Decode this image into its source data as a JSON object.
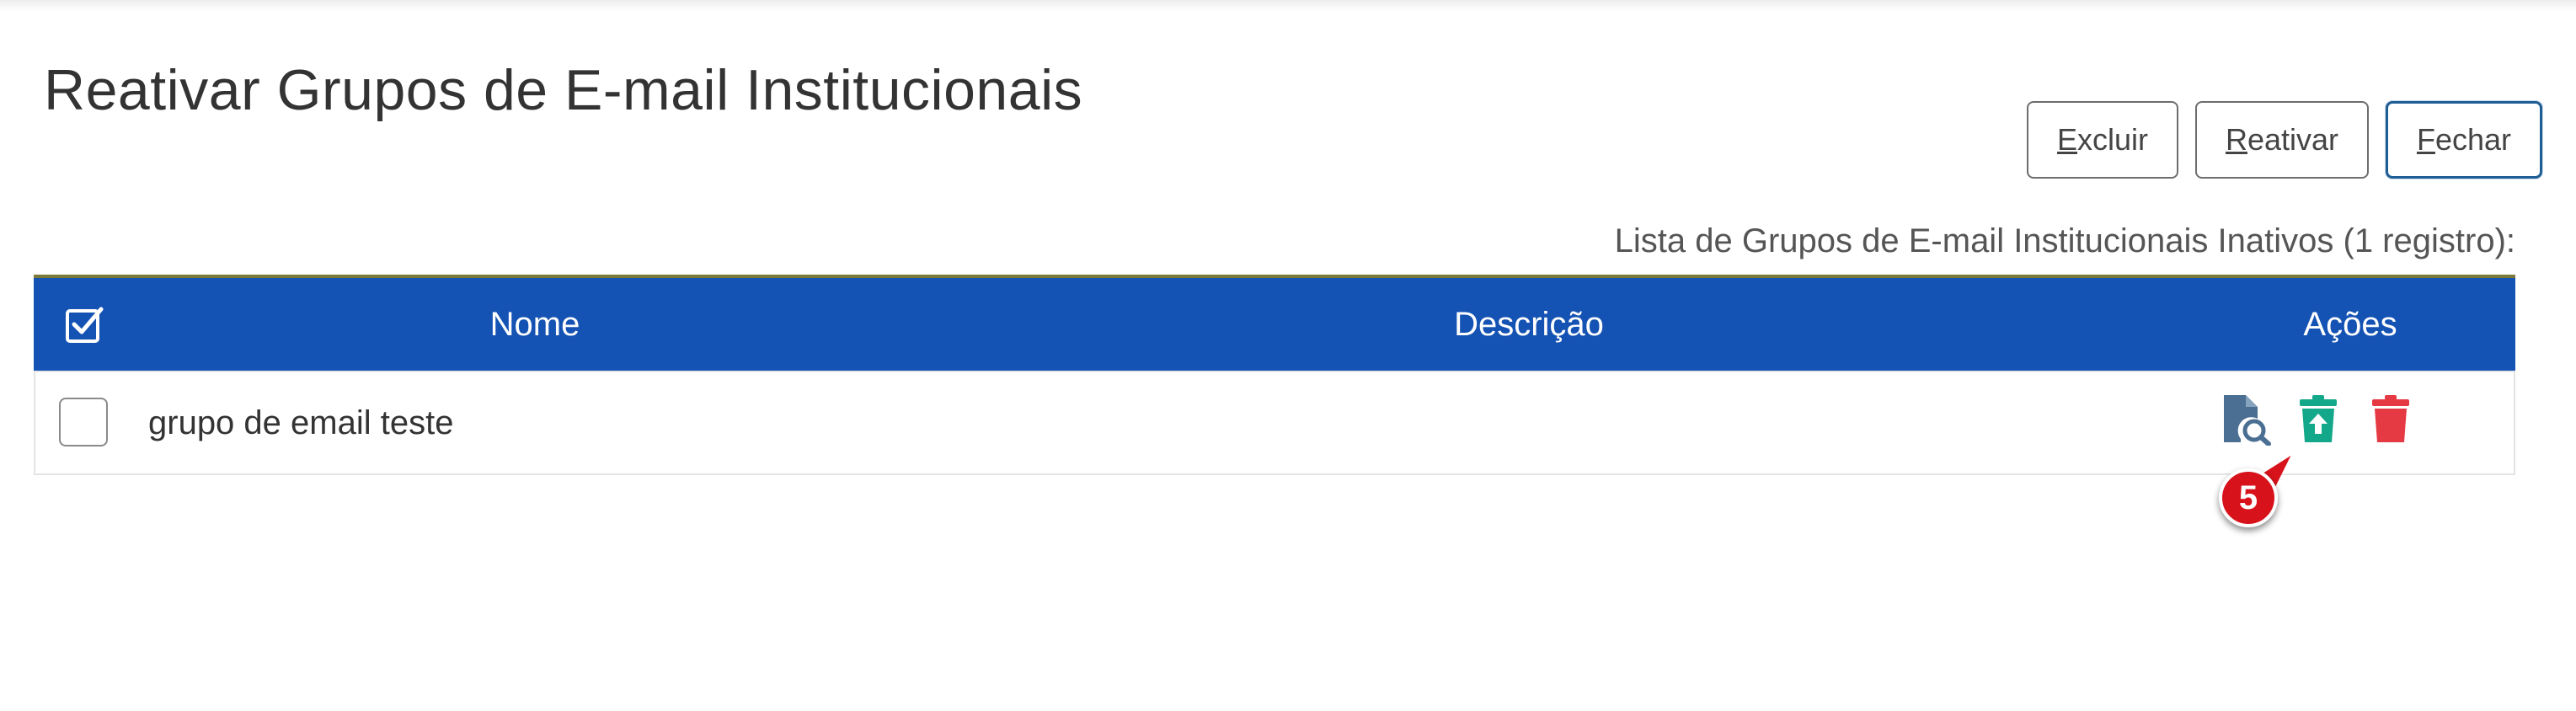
{
  "page": {
    "title": "Reativar Grupos de E-mail Institucionais"
  },
  "toolbar": {
    "excluir": {
      "mnemonic": "E",
      "rest": "xcluir"
    },
    "reativar": {
      "mnemonic": "R",
      "rest": "eativar"
    },
    "fechar": {
      "mnemonic": "F",
      "rest": "echar"
    }
  },
  "table": {
    "caption": "Lista de Grupos de E-mail Institucionais Inativos (1 registro):",
    "headers": {
      "nome": "Nome",
      "descricao": "Descrição",
      "acoes": "Ações"
    },
    "rows": [
      {
        "nome": "grupo de email teste",
        "descricao": "",
        "selected": false
      }
    ]
  },
  "annotation": {
    "badge_number": "5"
  },
  "colors": {
    "header_bg": "#1452b3",
    "gold_line": "#7b7a3a",
    "view_icon": "#4a6f92",
    "reactivate_icon": "#14a88a",
    "delete_icon": "#e53943",
    "badge": "#d8121b"
  },
  "icons": {
    "header_check": "checkbox-checked-icon",
    "view": "document-search-icon",
    "reactivate": "trash-restore-icon",
    "delete": "trash-icon"
  }
}
